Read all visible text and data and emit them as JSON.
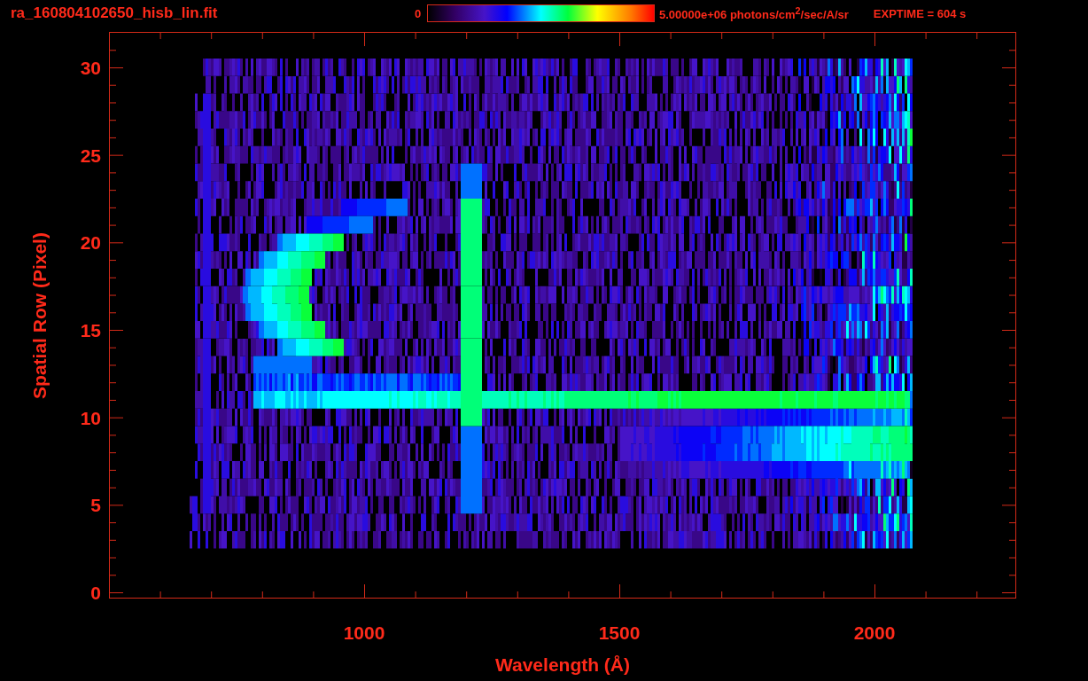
{
  "plot": {
    "title": "ra_160804102650_hisb_lin.fit",
    "colorbar": {
      "min_label": "0",
      "max_label": "5.00000e+06 photons/cm$^{2}$/sec/A/sr"
    },
    "exposure": "EXPTIME = 604 s",
    "ylabel": "Spatial Row (Pixel)",
    "yticks": [
      "30",
      "25",
      "20",
      "15",
      "10",
      "5",
      "0"
    ],
    "xticks": [
      "1000",
      "1500",
      "2000"
    ],
    "xlabel": "Wavelength (Å)"
  }
}
